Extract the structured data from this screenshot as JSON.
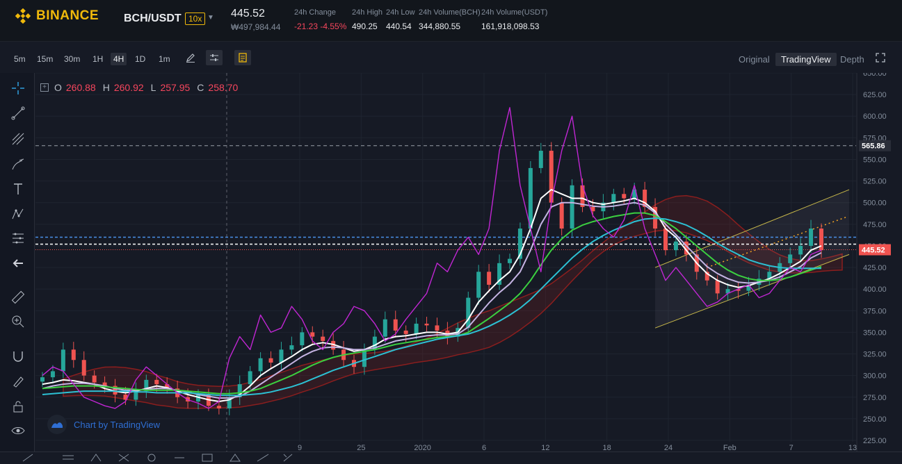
{
  "header": {
    "logo_text": "BINANCE",
    "pair": "BCH/USDT",
    "leverage": "10x",
    "last_price": "445.52",
    "last_price_fiat": "₩497,984.44",
    "stats": [
      {
        "label": "24h Change",
        "value": "-21.23 -4.55%",
        "negative": true
      },
      {
        "label": "24h High",
        "value": "490.25",
        "negative": false
      },
      {
        "label": "24h Low",
        "value": "440.54",
        "negative": false
      },
      {
        "label": "24h Volume(BCH)",
        "value": "344,880.55",
        "negative": false
      },
      {
        "label": "24h Volume(USDT)",
        "value": "161,918,098.53",
        "negative": false
      }
    ]
  },
  "toolbar": {
    "timeframes": [
      "5m",
      "15m",
      "30m",
      "1H",
      "4H",
      "1D",
      "1m"
    ],
    "active_timeframe": "4H",
    "views": [
      "Original",
      "TradingView",
      "Depth"
    ],
    "active_view": "TradingView"
  },
  "legend": {
    "o_label": "O",
    "o_value": "260.88",
    "h_label": "H",
    "h_value": "260.92",
    "l_label": "L",
    "l_value": "257.95",
    "c_label": "C",
    "c_value": "258.70"
  },
  "watermark": "Chart by TradingView",
  "colors": {
    "up": "#26a69a",
    "down": "#ef5350",
    "accent": "#f0b90b",
    "background": "#161a25"
  },
  "chart_data": {
    "type": "candlestick",
    "y_axis_ticks": [
      "650.00",
      "625.00",
      "600.00",
      "575.00",
      "550.00",
      "525.00",
      "500.00",
      "475.00",
      "450.00",
      "425.00",
      "400.00",
      "375.00",
      "350.00",
      "325.00",
      "300.00",
      "275.00",
      "250.00",
      "225.00"
    ],
    "ylim": [
      225,
      650
    ],
    "x_axis_ticks": [
      "9",
      "25",
      "2020",
      "6",
      "12",
      "18",
      "24",
      "Feb",
      "7",
      "13"
    ],
    "price_labels": [
      {
        "value": "565.86",
        "style": "dashed-grey"
      },
      {
        "value": "445.52",
        "style": "current-red"
      }
    ],
    "horizontal_lines": [
      {
        "value": 565.86,
        "style": "dashed-grey"
      },
      {
        "value": 460.0,
        "style": "dashed-blue"
      },
      {
        "value": 452.0,
        "style": "dashed-white"
      },
      {
        "value": 445.52,
        "style": "dotted-red"
      }
    ],
    "close_path": [
      298,
      305,
      330,
      318,
      300,
      292,
      288,
      278,
      272,
      282,
      295,
      290,
      285,
      275,
      270,
      278,
      265,
      262,
      275,
      290,
      305,
      320,
      315,
      330,
      335,
      350,
      345,
      340,
      330,
      318,
      310,
      330,
      345,
      365,
      352,
      348,
      360,
      358,
      352,
      345,
      355,
      390,
      420,
      405,
      430,
      435,
      470,
      540,
      560,
      500,
      470,
      520,
      495,
      490,
      500,
      510,
      505,
      515,
      495,
      470,
      445,
      455,
      440,
      420,
      410,
      395,
      400,
      398,
      405,
      412,
      420,
      430,
      440,
      450,
      470,
      445
    ],
    "moving_averages": [
      {
        "name": "white",
        "color": "#ffffff",
        "values": [
          290,
          292,
          295,
          294,
          292,
          290,
          285,
          282,
          280,
          282,
          285,
          288,
          286,
          282,
          278,
          275,
          272,
          270,
          272,
          278,
          288,
          300,
          308,
          315,
          322,
          330,
          336,
          338,
          336,
          332,
          328,
          330,
          335,
          342,
          345,
          346,
          348,
          350,
          350,
          348,
          350,
          365,
          385,
          398,
          410,
          420,
          440,
          470,
          505,
          515,
          510,
          505,
          505,
          500,
          498,
          500,
          502,
          505,
          500,
          490,
          470,
          460,
          445,
          430,
          418,
          410,
          405,
          402,
          404,
          408,
          412,
          418,
          425,
          432,
          445,
          450
        ]
      },
      {
        "name": "lavender",
        "color": "#c5b4e3",
        "values": [
          285,
          288,
          290,
          291,
          291,
          290,
          288,
          285,
          283,
          283,
          284,
          285,
          285,
          283,
          281,
          278,
          276,
          274,
          274,
          276,
          282,
          290,
          298,
          306,
          314,
          322,
          328,
          332,
          333,
          332,
          330,
          330,
          332,
          336,
          340,
          342,
          344,
          346,
          347,
          347,
          348,
          356,
          370,
          384,
          396,
          406,
          420,
          445,
          475,
          495,
          500,
          500,
          498,
          496,
          495,
          496,
          498,
          500,
          497,
          488,
          475,
          463,
          450,
          438,
          426,
          418,
          412,
          408,
          407,
          408,
          410,
          414,
          420,
          426,
          436,
          442
        ]
      },
      {
        "name": "green",
        "color": "#3bd040",
        "values": [
          285,
          286,
          287,
          288,
          288,
          288,
          287,
          286,
          285,
          284,
          283,
          283,
          283,
          283,
          282,
          281,
          280,
          279,
          279,
          280,
          282,
          285,
          290,
          295,
          300,
          306,
          312,
          317,
          321,
          324,
          326,
          328,
          330,
          333,
          336,
          338,
          340,
          342,
          344,
          345,
          346,
          350,
          358,
          366,
          375,
          384,
          395,
          410,
          428,
          445,
          458,
          468,
          474,
          478,
          481,
          484,
          486,
          488,
          488,
          485,
          478,
          470,
          460,
          450,
          440,
          430,
          422,
          416,
          412,
          410,
          410,
          411,
          414,
          418,
          422,
          426
        ]
      },
      {
        "name": "cyan",
        "color": "#2cc1d4",
        "values": [
          278,
          279,
          280,
          281,
          282,
          282,
          282,
          282,
          282,
          281,
          281,
          280,
          280,
          280,
          280,
          279,
          278,
          277,
          277,
          277,
          278,
          279,
          281,
          284,
          287,
          291,
          296,
          301,
          306,
          310,
          314,
          318,
          322,
          326,
          330,
          333,
          336,
          339,
          342,
          344,
          346,
          348,
          352,
          357,
          363,
          370,
          378,
          388,
          400,
          412,
          424,
          436,
          446,
          455,
          462,
          468,
          473,
          478,
          481,
          482,
          481,
          478,
          474,
          468,
          461,
          453,
          446,
          440,
          434,
          430,
          427,
          425,
          424,
          424,
          424,
          424
        ]
      },
      {
        "name": "magenta",
        "color": "#c026d3",
        "values": [
          300,
          310,
          305,
          290,
          275,
          270,
          265,
          262,
          270,
          295,
          310,
          300,
          290,
          280,
          272,
          268,
          262,
          270,
          320,
          345,
          330,
          370,
          350,
          355,
          380,
          365,
          340,
          330,
          350,
          360,
          380,
          375,
          360,
          340,
          348,
          365,
          380,
          395,
          430,
          420,
          445,
          460,
          440,
          470,
          560,
          610,
          520,
          470,
          420,
          500,
          560,
          600,
          520,
          485,
          470,
          460,
          480,
          520,
          470,
          440,
          410,
          425,
          410,
          395,
          380,
          385,
          395,
          400,
          405,
          390,
          395,
          410,
          425,
          420,
          440,
          445
        ]
      }
    ],
    "annotations": [
      {
        "type": "ascending-channel",
        "color": "#c9b94a"
      },
      {
        "type": "dotted-projection",
        "color": "#f5a623"
      },
      {
        "type": "ichimoku-cloud",
        "colors": [
          "#8b1e1e",
          "#1e5e1e"
        ]
      }
    ]
  }
}
